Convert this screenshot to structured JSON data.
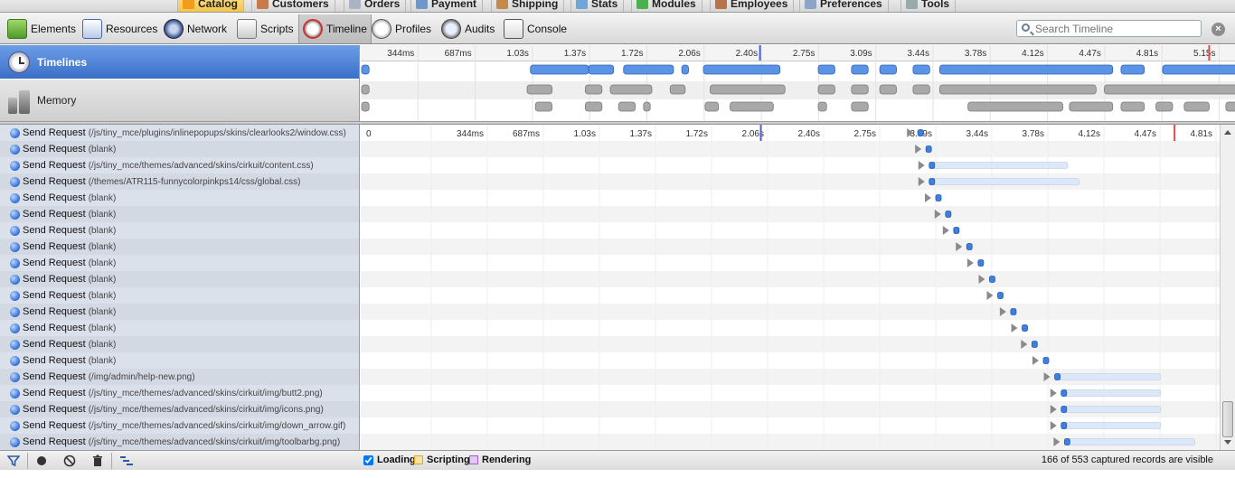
{
  "app_tabs": [
    {
      "label": "Catalog",
      "active": true
    },
    {
      "label": "Customers"
    },
    {
      "label": "Orders"
    },
    {
      "label": "Payment"
    },
    {
      "label": "Shipping"
    },
    {
      "label": "Stats"
    },
    {
      "label": "Modules"
    },
    {
      "label": "Employees"
    },
    {
      "label": "Preferences"
    },
    {
      "label": "Tools"
    }
  ],
  "toolbar": {
    "panels": [
      {
        "label": "Elements",
        "icon": "elements-icon"
      },
      {
        "label": "Resources",
        "icon": "resources-icon"
      },
      {
        "label": "Network",
        "icon": "network-icon"
      },
      {
        "label": "Scripts",
        "icon": "scripts-icon"
      },
      {
        "label": "Timeline",
        "icon": "timeline-icon",
        "selected": true
      },
      {
        "label": "Profiles",
        "icon": "profiles-icon"
      },
      {
        "label": "Audits",
        "icon": "audits-icon"
      },
      {
        "label": "Console",
        "icon": "console-icon"
      }
    ],
    "search_placeholder": "Search Timeline"
  },
  "overview": {
    "timelines_label": "Timelines",
    "memory_label": "Memory",
    "ticks": [
      "344ms",
      "687ms",
      "1.03s",
      "1.37s",
      "1.72s",
      "2.06s",
      "2.40s",
      "2.75s",
      "3.09s",
      "3.44s",
      "3.78s",
      "4.12s",
      "4.47s",
      "4.81s",
      "5.15s"
    ],
    "loading_spans": [
      [
        0.0,
        0.05
      ],
      [
        1.02,
        1.37
      ],
      [
        1.37,
        1.52
      ],
      [
        1.58,
        1.88
      ],
      [
        1.93,
        1.97
      ],
      [
        2.06,
        2.52
      ],
      [
        2.75,
        2.85
      ],
      [
        2.95,
        3.05
      ],
      [
        3.12,
        3.22
      ],
      [
        3.32,
        3.42
      ],
      [
        3.48,
        4.52
      ],
      [
        4.57,
        4.71
      ],
      [
        4.82,
        5.35
      ]
    ],
    "scripting_spans": [
      [
        0.0,
        0.05
      ],
      [
        1.0,
        1.15
      ],
      [
        1.35,
        1.45
      ],
      [
        1.5,
        1.75
      ],
      [
        1.86,
        1.95
      ],
      [
        2.1,
        2.55
      ],
      [
        2.75,
        2.85
      ],
      [
        2.95,
        3.05
      ],
      [
        3.12,
        3.22
      ],
      [
        3.32,
        3.42
      ],
      [
        3.48,
        4.42
      ],
      [
        4.47,
        5.4
      ]
    ],
    "rendering_spans": [
      [
        0.0,
        0.05
      ],
      [
        1.05,
        1.15
      ],
      [
        1.35,
        1.45
      ],
      [
        1.55,
        1.65
      ],
      [
        1.7,
        1.74
      ],
      [
        2.07,
        2.15
      ],
      [
        2.22,
        2.48
      ],
      [
        2.75,
        2.8
      ],
      [
        2.95,
        3.05
      ],
      [
        3.65,
        4.22
      ],
      [
        4.26,
        4.52
      ],
      [
        4.57,
        4.71
      ],
      [
        4.78,
        4.88
      ],
      [
        4.95,
        5.1
      ],
      [
        5.2,
        5.4
      ]
    ],
    "blue_marker": 2.4,
    "red_marker": 5.1
  },
  "records": {
    "ticks": [
      "0",
      "344ms",
      "687ms",
      "1.03s",
      "1.37s",
      "1.72s",
      "2.06s",
      "2.40s",
      "2.75s",
      "3.09s",
      "3.44s",
      "3.78s",
      "4.12s",
      "4.47s",
      "4.81s",
      "5.15s"
    ],
    "blue_marker": 2.4,
    "red_marker": 4.95,
    "rows": [
      {
        "title": "Send Request",
        "detail": "(/js/tiny_mce/plugins/inlinepopups/skins/clearlooks2/window.css)",
        "start": 3.33,
        "end": 3.33
      },
      {
        "title": "Send Request",
        "detail": "(blank)",
        "start": 3.38,
        "end": 3.38
      },
      {
        "title": "Send Request",
        "detail": "(/js/tiny_mce/themes/advanced/skins/cirkuit/content.css)",
        "start": 3.4,
        "end": 4.25
      },
      {
        "title": "Send Request",
        "detail": "(/themes/ATR115-funnycolorpinkps14/css/global.css)",
        "start": 3.4,
        "end": 4.32
      },
      {
        "title": "Send Request",
        "detail": "(blank)",
        "start": 3.44,
        "end": 3.44
      },
      {
        "title": "Send Request",
        "detail": "(blank)",
        "start": 3.5,
        "end": 3.5
      },
      {
        "title": "Send Request",
        "detail": "(blank)",
        "start": 3.55,
        "end": 3.55
      },
      {
        "title": "Send Request",
        "detail": "(blank)",
        "start": 3.63,
        "end": 3.63
      },
      {
        "title": "Send Request",
        "detail": "(blank)",
        "start": 3.7,
        "end": 3.7
      },
      {
        "title": "Send Request",
        "detail": "(blank)",
        "start": 3.77,
        "end": 3.77
      },
      {
        "title": "Send Request",
        "detail": "(blank)",
        "start": 3.82,
        "end": 3.82
      },
      {
        "title": "Send Request",
        "detail": "(blank)",
        "start": 3.9,
        "end": 3.9
      },
      {
        "title": "Send Request",
        "detail": "(blank)",
        "start": 3.97,
        "end": 3.97
      },
      {
        "title": "Send Request",
        "detail": "(blank)",
        "start": 4.03,
        "end": 4.03
      },
      {
        "title": "Send Request",
        "detail": "(blank)",
        "start": 4.1,
        "end": 4.1
      },
      {
        "title": "Send Request",
        "detail": "(/img/admin/help-new.png)",
        "start": 4.17,
        "end": 4.82
      },
      {
        "title": "Send Request",
        "detail": "(/js/tiny_mce/themes/advanced/skins/cirkuit/img/butt2.png)",
        "start": 4.21,
        "end": 4.82
      },
      {
        "title": "Send Request",
        "detail": "(/js/tiny_mce/themes/advanced/skins/cirkuit/img/icons.png)",
        "start": 4.21,
        "end": 4.82
      },
      {
        "title": "Send Request",
        "detail": "(/js/tiny_mce/themes/advanced/skins/cirkuit/img/down_arrow.gif)",
        "start": 4.21,
        "end": 4.82
      },
      {
        "title": "Send Request",
        "detail": "(/js/tiny_mce/themes/advanced/skins/cirkuit/img/toolbarbg.png)",
        "start": 4.23,
        "end": 5.03
      }
    ]
  },
  "status": {
    "legend": [
      {
        "label": "Loading",
        "color": "#4a86e8",
        "checked": true
      },
      {
        "label": "Scripting",
        "color": "#f3c04a",
        "checked": false
      },
      {
        "label": "Rendering",
        "color": "#b886d8",
        "checked": false
      }
    ],
    "count_text": "166 of 553 captured records are visible"
  },
  "colors": {
    "loading_bar": "#5b93e6",
    "gray_bar": "#a9a9a9",
    "blue_marker": "#4a5fe0",
    "red_marker": "#e04a4a"
  }
}
